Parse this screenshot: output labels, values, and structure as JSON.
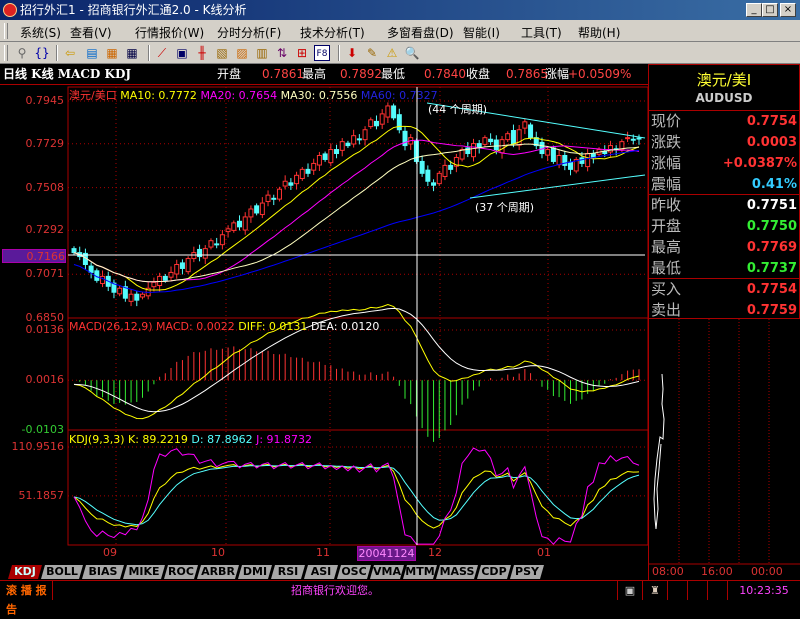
{
  "window": {
    "title": "招行外汇1 - 招商银行外汇通2.0 - K线分析",
    "minimize": "_",
    "maximize": "□",
    "close": "×"
  },
  "menu": [
    "系统(S)",
    "查看(V)",
    "行情报价(W)",
    "分时分析(F)",
    "技术分析(T)",
    "多窗看盘(D)",
    "智能(I)",
    "工具(T)",
    "帮助(H)"
  ],
  "toolbar": [
    {
      "icon": "link-icon",
      "glyph": "⚲",
      "color": "#666"
    },
    {
      "icon": "bracket-icon",
      "glyph": "{}",
      "color": "#00a"
    },
    {
      "icon": "back-arrow-icon",
      "glyph": "⇦",
      "color": "#c90"
    },
    {
      "icon": "report-icon",
      "glyph": "▤",
      "color": "#06c"
    },
    {
      "icon": "quote-table-icon",
      "glyph": "▦",
      "color": "#c60"
    },
    {
      "icon": "grid-table-icon",
      "glyph": "▦",
      "color": "#004"
    },
    {
      "icon": "line-chart-icon",
      "glyph": "⟋",
      "color": "#c00"
    },
    {
      "icon": "window-icon",
      "glyph": "▣",
      "color": "#006"
    },
    {
      "icon": "candlestick-icon",
      "glyph": "╫",
      "color": "#c00"
    },
    {
      "icon": "chart-window-icon",
      "glyph": "▧",
      "color": "#960"
    },
    {
      "icon": "trend-window-icon",
      "glyph": "▨",
      "color": "#c60"
    },
    {
      "icon": "bars-window-icon",
      "glyph": "▥",
      "color": "#960"
    },
    {
      "icon": "arrows-icon",
      "glyph": "⇅",
      "color": "#606"
    },
    {
      "icon": "multi-chart-icon",
      "glyph": "⊞",
      "color": "#c00"
    },
    {
      "icon": "f8-icon",
      "glyph": "F8",
      "color": "#006"
    },
    {
      "icon": "download-icon",
      "glyph": "⬇",
      "color": "#c00"
    },
    {
      "icon": "pencil-icon",
      "glyph": "✎",
      "color": "#960"
    },
    {
      "icon": "warning-icon",
      "glyph": "⚠",
      "color": "#c90"
    },
    {
      "icon": "magnifier-icon",
      "glyph": "🔍",
      "color": "#960"
    }
  ],
  "info": {
    "title": "日线 K线 MACD KDJ",
    "open_label": "开盘",
    "open": "0.7861",
    "high_label": "最高",
    "high": "0.7892",
    "low_label": "最低",
    "low": "0.7840",
    "close_label": "收盘",
    "close": "0.7865",
    "change_label": "涨幅",
    "change": "+0.0509%"
  },
  "main_legend": {
    "name": "澳元/美口",
    "ma10": "MA10: 0.7772",
    "ma20": "MA20: 0.7654",
    "ma30": "MA30: 0.7556",
    "ma60": "MA60: 0.7327"
  },
  "macd_legend": {
    "macd": "MACD(26,12,9) MACD: 0.0022",
    "diff": "DIFF: 0.0131",
    "dea": "DEA: 0.0120"
  },
  "kdj_legend": {
    "name": "KDJ(9,3,3)",
    "k": "K: 89.2219",
    "d": "D: 87.8962",
    "j": "J: 91.8732"
  },
  "annotations": {
    "upper": "(44 个周期)",
    "lower": "(37 个周期)"
  },
  "chart_data": {
    "type": "candlestick",
    "main_ylim": [
      0.685,
      0.7945
    ],
    "main_ticks": [
      "0.7945",
      "0.7729",
      "0.7508",
      "0.7292",
      "0.7071",
      "0.6850"
    ],
    "crosshair_value": "0.7166",
    "macd_ylim": [
      -0.0103,
      0.0136
    ],
    "macd_ticks": [
      "0.0136",
      "0.0016",
      "-0.0103"
    ],
    "kdj_ticks": [
      "110.9516",
      "51.1857"
    ],
    "kdj_ylim": [
      -9,
      110.9516
    ],
    "x_labels": [
      "09",
      "10",
      "11",
      "12",
      "01"
    ],
    "crosshair_date": "20041124",
    "close": [
      0.718,
      0.716,
      0.712,
      0.708,
      0.704,
      0.706,
      0.701,
      0.698,
      0.7,
      0.695,
      0.697,
      0.694,
      0.697,
      0.7,
      0.703,
      0.706,
      0.704,
      0.708,
      0.712,
      0.71,
      0.715,
      0.718,
      0.716,
      0.72,
      0.724,
      0.722,
      0.727,
      0.73,
      0.733,
      0.731,
      0.736,
      0.74,
      0.738,
      0.743,
      0.747,
      0.745,
      0.75,
      0.754,
      0.752,
      0.757,
      0.76,
      0.758,
      0.763,
      0.767,
      0.765,
      0.77,
      0.768,
      0.774,
      0.772,
      0.777,
      0.775,
      0.78,
      0.785,
      0.782,
      0.788,
      0.792,
      0.786,
      0.78,
      0.772,
      0.776,
      0.764,
      0.758,
      0.754,
      0.752,
      0.758,
      0.762,
      0.76,
      0.766,
      0.77,
      0.768,
      0.773,
      0.771,
      0.776,
      0.774,
      0.77,
      0.775,
      0.778,
      0.773,
      0.78,
      0.784,
      0.776,
      0.772,
      0.768,
      0.77,
      0.764,
      0.767,
      0.762,
      0.76,
      0.765,
      0.763,
      0.768,
      0.766,
      0.77,
      0.768,
      0.772,
      0.77,
      0.774,
      0.776,
      0.775,
      0.7754
    ],
    "colors": {
      "up": "#ff3232",
      "down": "#54fcfc",
      "ma10": "#ffff00",
      "ma20": "#ff00ff",
      "ma30": "#ffffc0",
      "ma60": "#0000ff"
    }
  },
  "quote": {
    "name": "澳元/美Ⅰ",
    "code": "AUDUSD",
    "rows": [
      {
        "label": "现价",
        "value": "0.7754",
        "color": "#f33"
      },
      {
        "label": "涨跌",
        "value": "0.0003",
        "color": "#f33"
      },
      {
        "label": "涨幅",
        "value": "+0.0387%",
        "color": "#f33"
      },
      {
        "label": "震幅",
        "value": "0.41%",
        "color": "#3cf"
      },
      {
        "label": "昨收",
        "value": "0.7751",
        "color": "#fff"
      },
      {
        "label": "开盘",
        "value": "0.7750",
        "color": "#3e3"
      },
      {
        "label": "最高",
        "value": "0.7769",
        "color": "#f33"
      },
      {
        "label": "最低",
        "value": "0.7737",
        "color": "#3e3"
      },
      {
        "label": "买入",
        "value": "0.7754",
        "color": "#f33"
      },
      {
        "label": "卖出",
        "value": "0.7759",
        "color": "#f33"
      }
    ]
  },
  "mini_times": [
    "08:00",
    "16:00",
    "00:00"
  ],
  "tabs": [
    "KDJ",
    "BOLL",
    "BIAS",
    "MIKE",
    "ROC",
    "ARBR",
    "DMI",
    "RSI",
    "ASI",
    "OSC",
    "VMA",
    "MTM",
    "MASS",
    "CDP",
    "PSY"
  ],
  "status": {
    "ticker": "滚 播 报 告",
    "message": "招商银行欢迎您。",
    "time": "10:23:35"
  }
}
